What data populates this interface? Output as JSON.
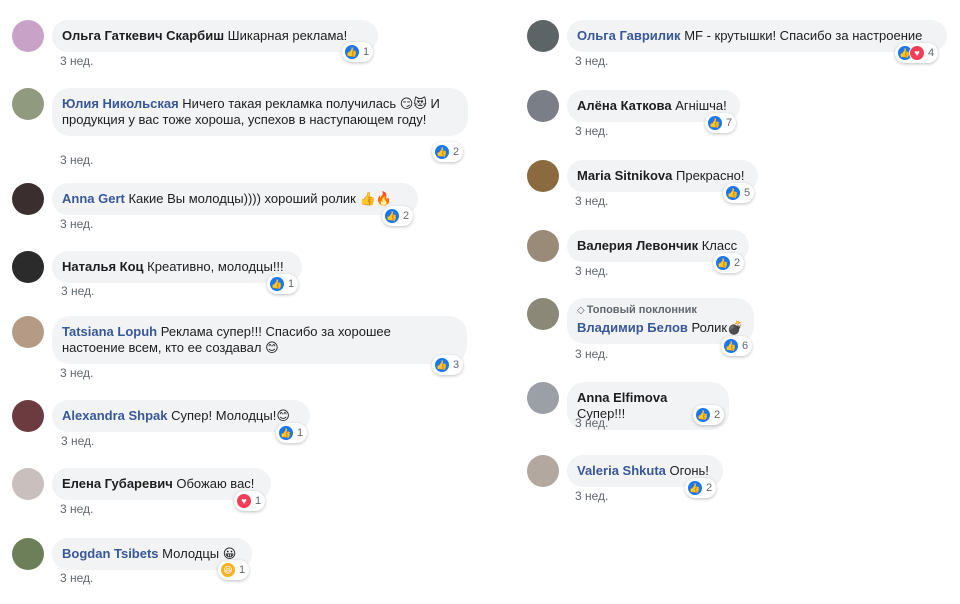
{
  "left_comments": [
    {
      "author": "Ольга Гаткевич Скарбиш",
      "author_style": "dark",
      "text": "Шикарная реклама!",
      "time": "3 нед.",
      "reactions": [
        "like"
      ],
      "count": "1",
      "avatar_color": "#c9a3c7"
    },
    {
      "author": "Юлия Никольская",
      "author_style": "link",
      "text": "Ничего такая рекламка получилась 😏😻 И продукция у вас тоже хороша, успехов в наступающем году!",
      "time": "3 нед.",
      "reactions": [
        "like"
      ],
      "count": "2",
      "avatar_color": "#8f9a7e"
    },
    {
      "author": "Anna Gert",
      "author_style": "link",
      "text": "Какие Вы молодцы)))) хороший ролик 👍🔥",
      "time": "3 нед.",
      "reactions": [
        "like"
      ],
      "count": "2",
      "avatar_color": "#3a2e2e"
    },
    {
      "author": "Наталья Коц",
      "author_style": "dark",
      "text": "Креативно, молодцы!!!",
      "time": "3 нед.",
      "reactions": [
        "like"
      ],
      "count": "1",
      "avatar_color": "#2b2b2b"
    },
    {
      "author": "Tatsiana Lopuh",
      "author_style": "link",
      "text": "Реклама супер!!! Спасибо за хорошее настоение всем, кто ее создавал 😊",
      "time": "3 нед.",
      "reactions": [
        "like"
      ],
      "count": "3",
      "avatar_color": "#b59a86"
    },
    {
      "author": "Alexandra Shpak",
      "author_style": "link",
      "text": "Супер! Молодцы!😊",
      "time": "3 нед.",
      "reactions": [
        "like"
      ],
      "count": "1",
      "avatar_color": "#6b3b3f"
    },
    {
      "author": "Елена Губаревич",
      "author_style": "dark",
      "text": "Обожаю вас!",
      "time": "3 нед.",
      "reactions": [
        "love"
      ],
      "count": "1",
      "avatar_color": "#c9c0bd"
    },
    {
      "author": "Bogdan Tsibets",
      "author_style": "link",
      "text": "Молодцы 😀",
      "time": "3 нед.",
      "reactions": [
        "haha"
      ],
      "count": "1",
      "avatar_color": "#6d7f58"
    }
  ],
  "right_comments": [
    {
      "author": "Ольга Гаврилик",
      "author_style": "link",
      "text": "MF - крутышки! Спасибо за настроение",
      "time": "3 нед.",
      "reactions": [
        "like",
        "love"
      ],
      "count": "4",
      "avatar_color": "#5c6468"
    },
    {
      "author": "Алёна Каткова",
      "author_style": "dark",
      "text": "Агнішча!",
      "time": "3 нед.",
      "reactions": [
        "like"
      ],
      "count": "7",
      "avatar_color": "#7a7e86"
    },
    {
      "author": "Maria Sitnikova",
      "author_style": "dark",
      "text": "Прекрасно!",
      "time": "3 нед.",
      "reactions": [
        "like"
      ],
      "count": "5",
      "avatar_color": "#8a6a3e"
    },
    {
      "author": "Валерия Левончик",
      "author_style": "dark",
      "text": "Класс",
      "time": "3 нед.",
      "reactions": [
        "like"
      ],
      "count": "2",
      "avatar_color": "#9a8a78"
    },
    {
      "author": "Владимир Белов",
      "author_style": "link",
      "top_fan": "Топовый поклонник",
      "text": "Ролик💣",
      "time": "3 нед.",
      "reactions": [
        "like"
      ],
      "count": "6",
      "avatar_color": "#8c8878"
    },
    {
      "author": "Anna Elfimova",
      "author_style": "dark",
      "text": "Супер!!!",
      "time": "3 нед.",
      "reactions": [
        "like"
      ],
      "count": "2",
      "avatar_color": "#9aa0a6"
    },
    {
      "author": "Valeria Shkuta",
      "author_style": "link",
      "text": "Огонь!",
      "time": "3 нед.",
      "reactions": [
        "like"
      ],
      "count": "2",
      "avatar_color": "#b2a8a0"
    }
  ],
  "icons": {
    "like": "👍",
    "love": "♥",
    "haha": "😆"
  }
}
